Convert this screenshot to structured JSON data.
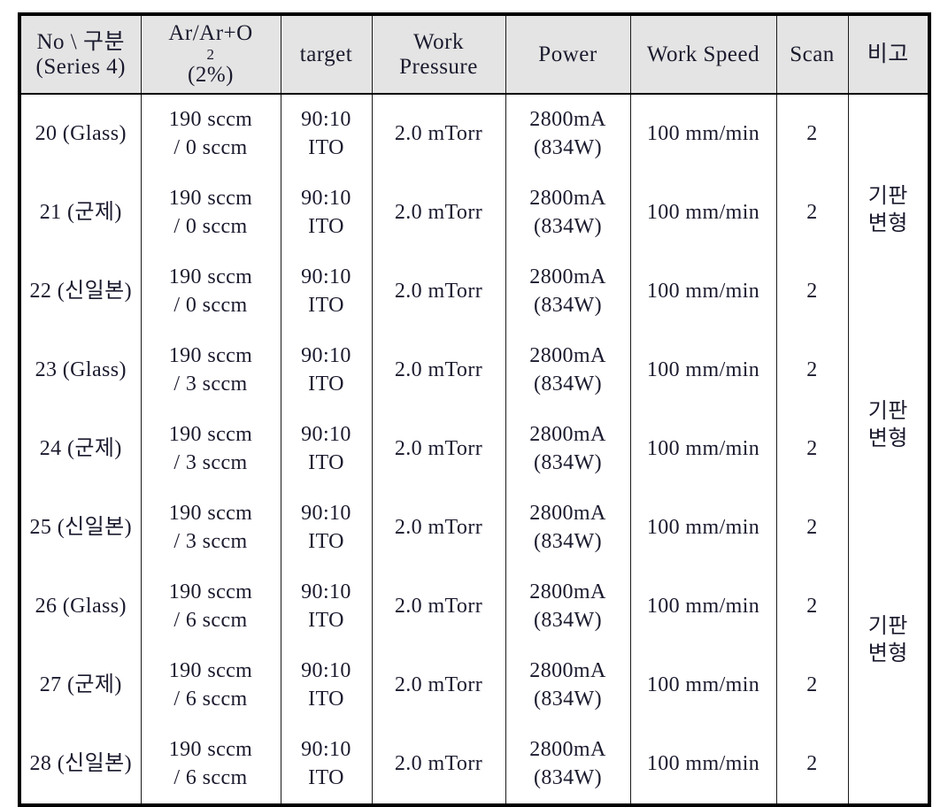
{
  "document": {
    "kind": "process-condition-table",
    "series_label": "Series 4",
    "background_color": "#ffffff",
    "header_background_color": "#e4e4e4",
    "border_color": "#000000",
    "text_color": "#1a1a2e"
  },
  "table": {
    "columns": [
      {
        "key": "no",
        "label_line1": "No \\ 구분",
        "label_line2": "(Series 4)"
      },
      {
        "key": "gas",
        "label_line1": "Ar/Ar+O",
        "label_sub": "2",
        "label_line2": "(2%)"
      },
      {
        "key": "target",
        "label_line1": "target",
        "label_line2": ""
      },
      {
        "key": "press",
        "label_line1": "Work",
        "label_line2": "Pressure"
      },
      {
        "key": "power",
        "label_line1": "Power",
        "label_line2": ""
      },
      {
        "key": "speed",
        "label_line1": "Work Speed",
        "label_line2": ""
      },
      {
        "key": "scan",
        "label_line1": "Scan",
        "label_line2": ""
      },
      {
        "key": "remark",
        "label_line1": "비고",
        "label_line2": ""
      }
    ],
    "rows": [
      {
        "no": "20 (Glass)",
        "gas_line1": "190 sccm",
        "gas_line2": "/ 0 sccm",
        "target_line1": "90:10",
        "target_line2": "ITO",
        "press": "2.0 mTorr",
        "power_line1": "2800mA",
        "power_line2": "(834W)",
        "speed": "100 mm/min",
        "scan": "2"
      },
      {
        "no": "21 (군제)",
        "gas_line1": "190 sccm",
        "gas_line2": "/ 0 sccm",
        "target_line1": "90:10",
        "target_line2": "ITO",
        "press": "2.0 mTorr",
        "power_line1": "2800mA",
        "power_line2": "(834W)",
        "speed": "100 mm/min",
        "scan": "2"
      },
      {
        "no": "22 (신일본)",
        "gas_line1": "190 sccm",
        "gas_line2": "/ 0 sccm",
        "target_line1": "90:10",
        "target_line2": "ITO",
        "press": "2.0 mTorr",
        "power_line1": "2800mA",
        "power_line2": "(834W)",
        "speed": "100 mm/min",
        "scan": "2"
      },
      {
        "no": "23 (Glass)",
        "gas_line1": "190 sccm",
        "gas_line2": "/ 3 sccm",
        "target_line1": "90:10",
        "target_line2": "ITO",
        "press": "2.0 mTorr",
        "power_line1": "2800mA",
        "power_line2": "(834W)",
        "speed": "100 mm/min",
        "scan": "2"
      },
      {
        "no": "24 (군제)",
        "gas_line1": "190 sccm",
        "gas_line2": "/ 3 sccm",
        "target_line1": "90:10",
        "target_line2": "ITO",
        "press": "2.0 mTorr",
        "power_line1": "2800mA",
        "power_line2": "(834W)",
        "speed": "100 mm/min",
        "scan": "2"
      },
      {
        "no": "25 (신일본)",
        "gas_line1": "190 sccm",
        "gas_line2": "/ 3 sccm",
        "target_line1": "90:10",
        "target_line2": "ITO",
        "press": "2.0 mTorr",
        "power_line1": "2800mA",
        "power_line2": "(834W)",
        "speed": "100 mm/min",
        "scan": "2"
      },
      {
        "no": "26 (Glass)",
        "gas_line1": "190 sccm",
        "gas_line2": "/ 6 sccm",
        "target_line1": "90:10",
        "target_line2": "ITO",
        "press": "2.0 mTorr",
        "power_line1": "2800mA",
        "power_line2": "(834W)",
        "speed": "100 mm/min",
        "scan": "2"
      },
      {
        "no": "27 (군제)",
        "gas_line1": "190 sccm",
        "gas_line2": "/ 6 sccm",
        "target_line1": "90:10",
        "target_line2": "ITO",
        "press": "2.0 mTorr",
        "power_line1": "2800mA",
        "power_line2": "(834W)",
        "speed": "100 mm/min",
        "scan": "2"
      },
      {
        "no": "28 (신일본)",
        "gas_line1": "190 sccm",
        "gas_line2": "/ 6 sccm",
        "target_line1": "90:10",
        "target_line2": "ITO",
        "press": "2.0 mTorr",
        "power_line1": "2800mA",
        "power_line2": "(834W)",
        "speed": "100 mm/min",
        "scan": "2"
      }
    ],
    "remark_column": {
      "entries": [
        {
          "line1": "기판",
          "line2": "변형",
          "applies_to_row": "21 (군제)"
        },
        {
          "line1": "기판",
          "line2": "변형",
          "applies_to_row": "24 (군제)"
        },
        {
          "line1": "기판",
          "line2": "변형",
          "applies_to_row": "27 (군제)"
        }
      ]
    }
  }
}
